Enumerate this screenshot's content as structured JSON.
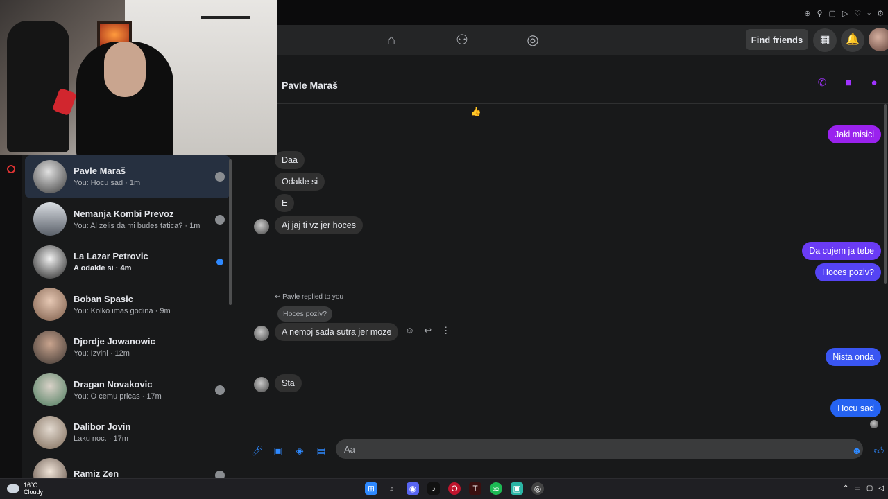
{
  "header": {
    "find_friends_label": "Find friends"
  },
  "chat": {
    "contact_name": "Pavle Maraš",
    "messages": {
      "m1": "Jaki misici",
      "m2": "Daa",
      "m3": "Odakle si",
      "m4": "E",
      "m5": "Aj jaj ti vz jer hoces",
      "m6": "Da cujem ja tebe",
      "m7": "Hoces poziv?",
      "reply_note": "Pavle replied to you",
      "reply_quote": "Hoces poziv?",
      "m8": "A nemoj sada sutra jer moze",
      "m9": "Nista onda",
      "m10": "Sta",
      "m11": "Hocu sad",
      "thumbs_emoji": "👍"
    },
    "composer_placeholder": "Aa"
  },
  "conversations": [
    {
      "name": "Pavle Maraš",
      "preview": "You: Hocu sad · 1m"
    },
    {
      "name": "Nemanja Kombi Prevoz",
      "preview": "You: Al zelis da mi budes tatica? · 1m"
    },
    {
      "name": "La Lazar Petrovic",
      "preview": "A odakle si · 4m"
    },
    {
      "name": "Boban Spasic",
      "preview": "You: Kolko imas godina · 9m"
    },
    {
      "name": "Djordje Jowanowic",
      "preview": "You: Izvini · 12m"
    },
    {
      "name": "Dragan Novakovic",
      "preview": "You: O cemu pricas · 17m"
    },
    {
      "name": "Dalibor Jovin",
      "preview": "Laku noc. · 17m"
    },
    {
      "name": "Ramiz Zen",
      "preview": ""
    }
  ],
  "taskbar": {
    "temp": "16°C",
    "weather": "Cloudy"
  },
  "colors": {
    "accent_purple": "#a033ff",
    "accent_blue": "#2e89ff",
    "bubble_gradient_top": "#a020f0",
    "bubble_gradient_bottom": "#1b6cf2"
  }
}
